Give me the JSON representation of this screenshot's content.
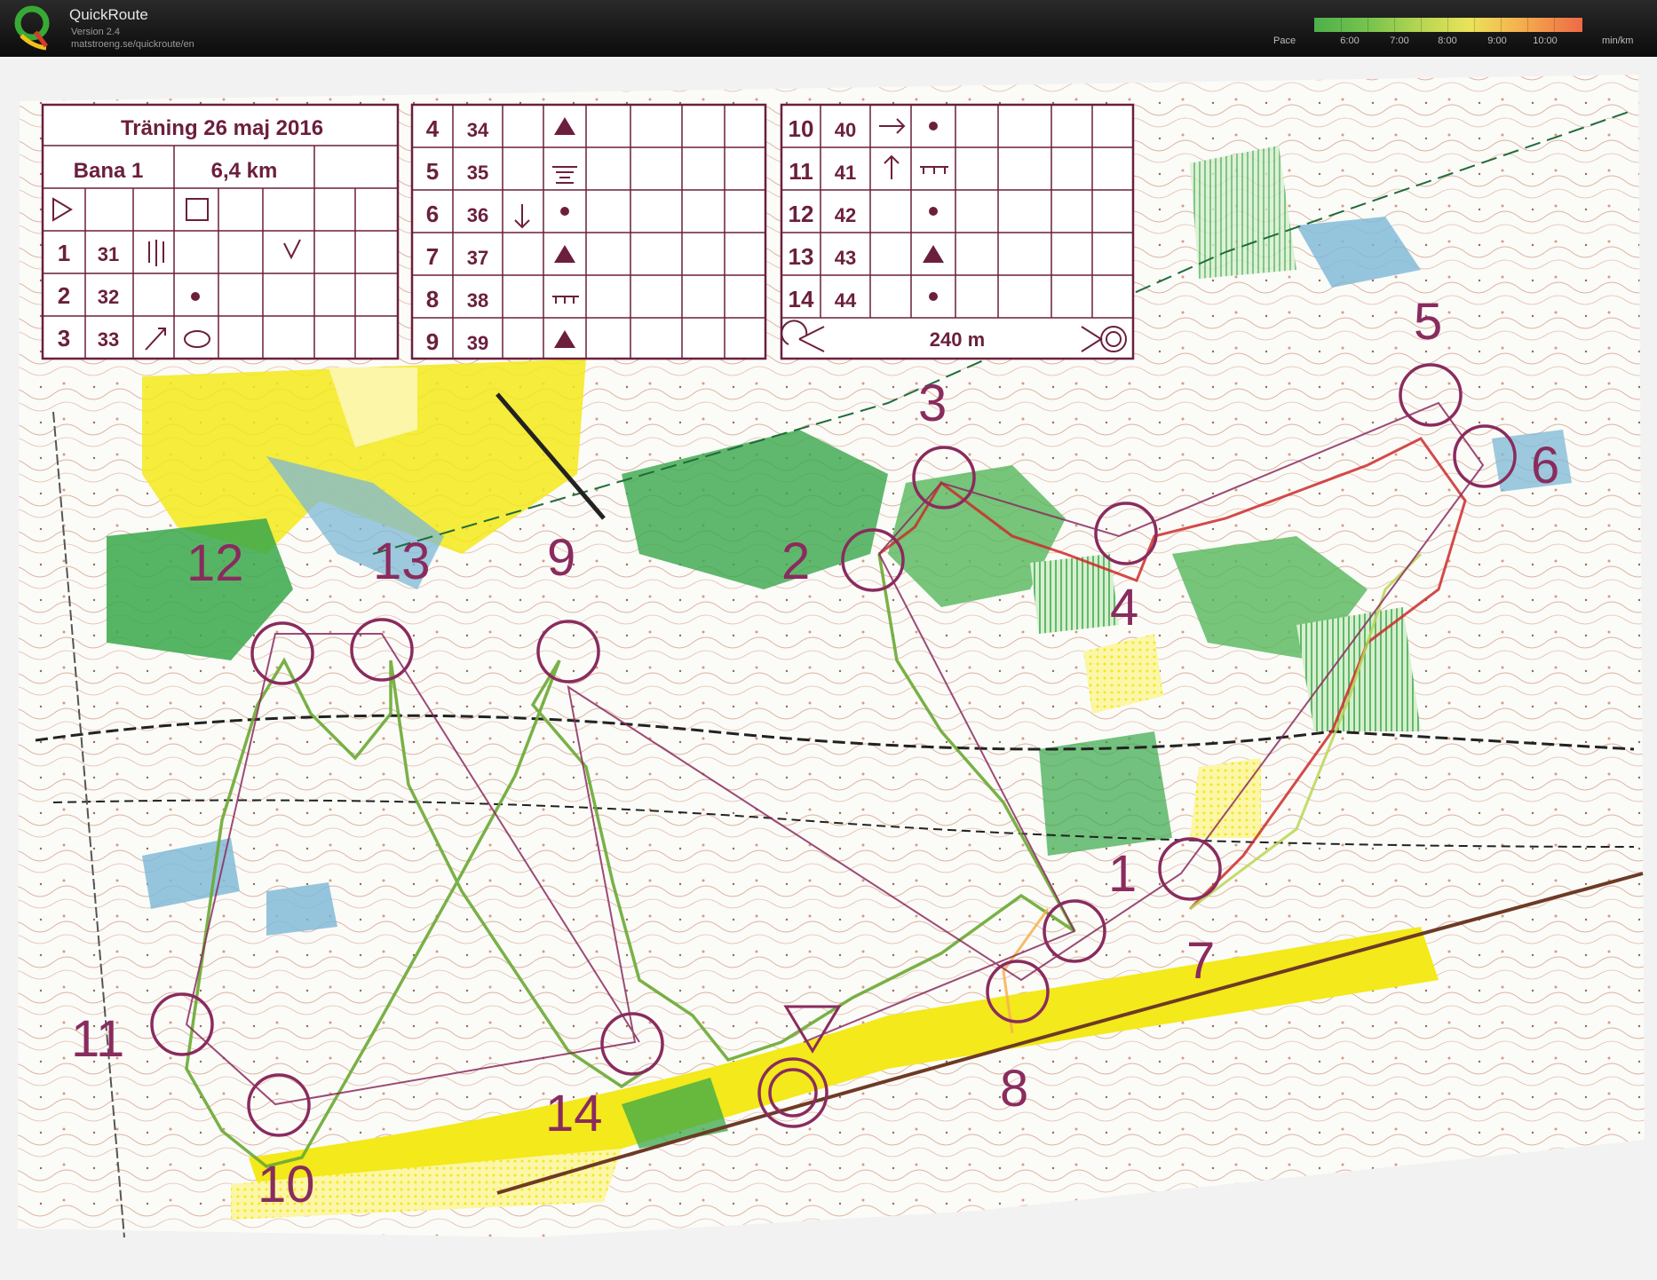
{
  "app": {
    "title": "QuickRoute",
    "version": "Version 2.4",
    "url": "matstroeng.se/quickroute/en"
  },
  "pace_legend": {
    "label": "Pace",
    "unit": "min/km",
    "ticks": [
      "6:00",
      "7:00",
      "8:00",
      "9:00",
      "10:00"
    ],
    "colors": [
      "#4cb04a",
      "#b8d652",
      "#e9e35a",
      "#f5b24e",
      "#ee6a45"
    ]
  },
  "colors": {
    "course_purple": "#8a2b5e",
    "route_green": "#6aa832",
    "route_red": "#cc2a2a",
    "vegetation_yellow": "#f3e91b",
    "forest_green": "#38a84a",
    "contour_brown": "#c97a5c",
    "water_blue": "#7cb8d6"
  },
  "control_description": {
    "event": "Träning 26 maj 2016",
    "course": "Bana 1",
    "length": "6,4 km",
    "controls": [
      {
        "num": "1",
        "code": "31"
      },
      {
        "num": "2",
        "code": "32"
      },
      {
        "num": "3",
        "code": "33"
      },
      {
        "num": "4",
        "code": "34"
      },
      {
        "num": "5",
        "code": "35"
      },
      {
        "num": "6",
        "code": "36"
      },
      {
        "num": "7",
        "code": "37"
      },
      {
        "num": "8",
        "code": "38"
      },
      {
        "num": "9",
        "code": "39"
      },
      {
        "num": "10",
        "code": "40"
      },
      {
        "num": "11",
        "code": "41"
      },
      {
        "num": "12",
        "code": "42"
      },
      {
        "num": "13",
        "code": "43"
      },
      {
        "num": "14",
        "code": "44"
      }
    ],
    "finish_distance": "240 m"
  },
  "map_labels": [
    "1",
    "2",
    "3",
    "4",
    "5",
    "6",
    "7",
    "8",
    "9",
    "10",
    "11",
    "12",
    "13",
    "14"
  ]
}
